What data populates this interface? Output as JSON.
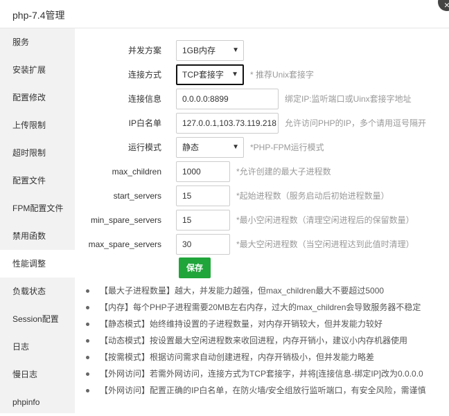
{
  "window": {
    "title": "php-7.4管理",
    "close_icon": "×"
  },
  "sidebar": {
    "items": [
      {
        "label": "服务"
      },
      {
        "label": "安装扩展"
      },
      {
        "label": "配置修改"
      },
      {
        "label": "上传限制"
      },
      {
        "label": "超时限制"
      },
      {
        "label": "配置文件"
      },
      {
        "label": "FPM配置文件"
      },
      {
        "label": "禁用函数"
      },
      {
        "label": "性能调整",
        "active": true
      },
      {
        "label": "负载状态"
      },
      {
        "label": "Session配置"
      },
      {
        "label": "日志"
      },
      {
        "label": "慢日志"
      },
      {
        "label": "phpinfo"
      }
    ]
  },
  "form": {
    "concurrency": {
      "label": "并发方案",
      "value": "1GB内存"
    },
    "connection": {
      "label": "连接方式",
      "value": "TCP套接字",
      "hint": "* 推荐Unix套接字"
    },
    "listen": {
      "label": "连接信息",
      "value": "0.0.0.0:8899",
      "hint": "绑定IP:监听端口或Uinx套接字地址"
    },
    "whitelist": {
      "label": "IP白名单",
      "value": "127.0.0.1,103.73.119.218",
      "hint": "允许访问PHP的IP，多个请用逗号隔开"
    },
    "run_mode": {
      "label": "运行模式",
      "value": "静态",
      "hint": "*PHP-FPM运行模式"
    },
    "max_children": {
      "label": "max_children",
      "value": "1000",
      "hint": "*允许创建的最大子进程数"
    },
    "start_servers": {
      "label": "start_servers",
      "value": "15",
      "hint": "*起始进程数（服务启动后初始进程数量）"
    },
    "min_spare_servers": {
      "label": "min_spare_servers",
      "value": "15",
      "hint": "*最小空闲进程数（清理空闲进程后的保留数量）"
    },
    "max_spare_servers": {
      "label": "max_spare_servers",
      "value": "30",
      "hint": "*最大空闲进程数（当空闲进程达到此值时清理）"
    },
    "save_label": "保存"
  },
  "notes": [
    "【最大子进程数量】越大，并发能力越强，但max_children最大不要超过5000",
    "【内存】每个PHP子进程需要20MB左右内存，过大的max_children会导致服务器不稳定",
    "【静态模式】始终维持设置的子进程数量，对内存开销较大，但并发能力较好",
    "【动态模式】按设置最大空闲进程数来收回进程，内存开销小，建议小内存机器使用",
    "【按需模式】根据访问需求自动创建进程，内存开销极小，但并发能力略差",
    "【外网访问】若需外网访问，连接方式为TCP套接字，并将[连接信息-绑定IP]改为0.0.0.0",
    "【外网访问】配置正确的IP白名单，在防火墙/安全组放行监听端口，有安全风险，需谨慎"
  ]
}
